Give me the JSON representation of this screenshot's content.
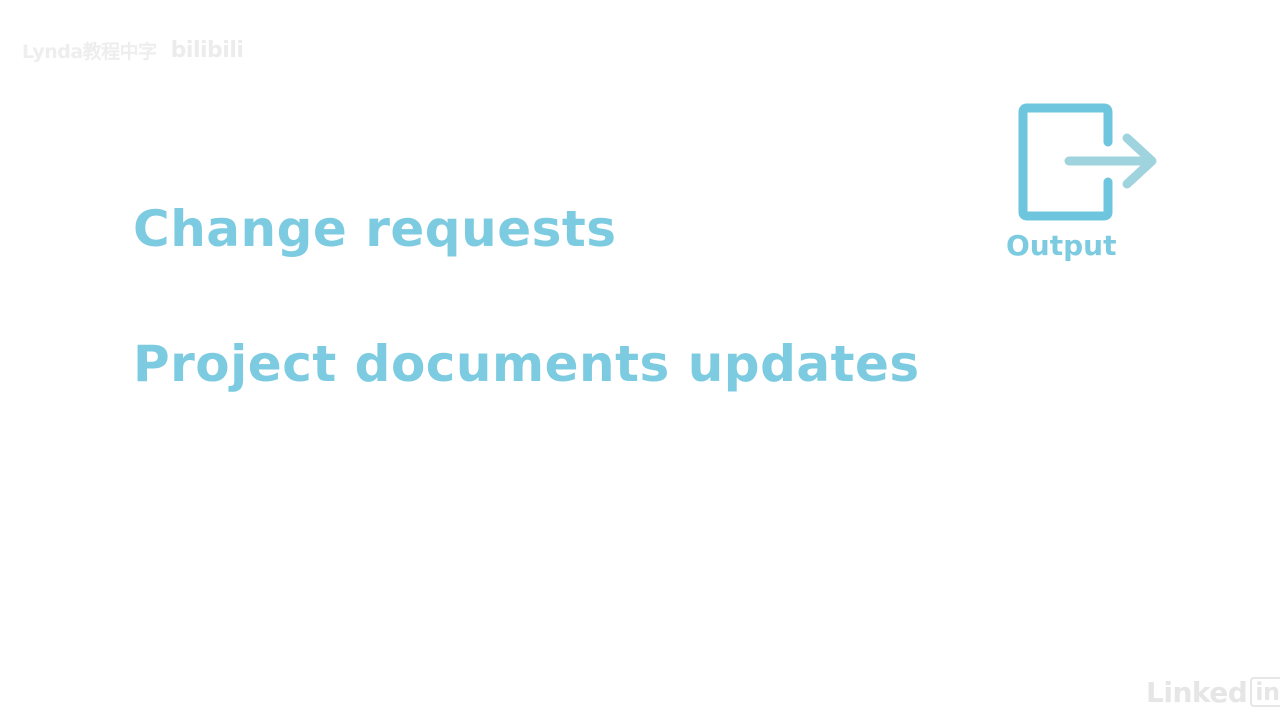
{
  "watermark": {
    "text": "Lynda教程中字",
    "bili": "bilibili"
  },
  "items": [
    "Change requests",
    "Project documents updates"
  ],
  "output": {
    "label": "Output",
    "icon": "output-exit-icon"
  },
  "branding": {
    "text": "Linked",
    "badge": "in"
  },
  "colors": {
    "accent": "#7ccbe0",
    "icon_frame": "#6ec6de",
    "icon_arrow": "#9fd3dd"
  }
}
